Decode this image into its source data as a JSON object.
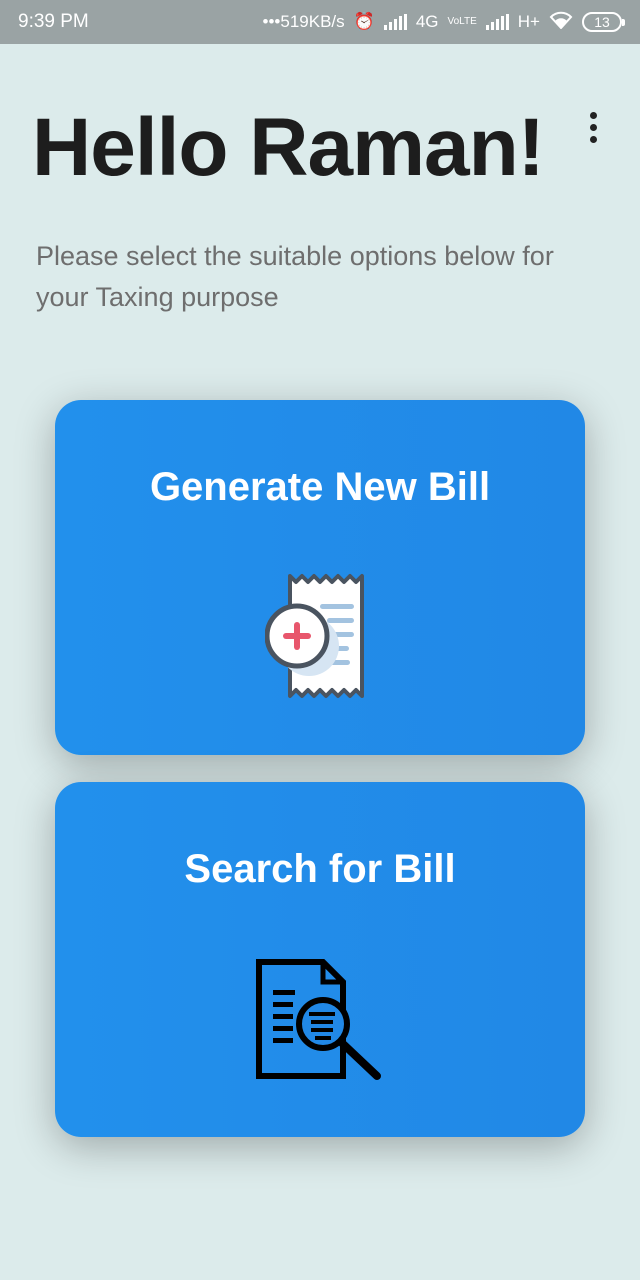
{
  "status_bar": {
    "time": "9:39 PM",
    "network_speed": "519KB/s",
    "net1": "4G",
    "volte": "VoLTE",
    "net2": "H+",
    "battery": "13"
  },
  "header": {
    "greeting": "Hello Raman!",
    "menu_icon": "more-vert-icon"
  },
  "subtitle": "Please select the suitable options below for your Taxing purpose",
  "cards": [
    {
      "label": "Generate New Bill",
      "icon": "receipt-add-icon"
    },
    {
      "label": "Search for Bill",
      "icon": "document-search-icon"
    }
  ],
  "colors": {
    "background": "#dcebeb",
    "card": "#2290ec",
    "status_bar": "#9aa3a4",
    "plus_accent": "#e8566c"
  }
}
